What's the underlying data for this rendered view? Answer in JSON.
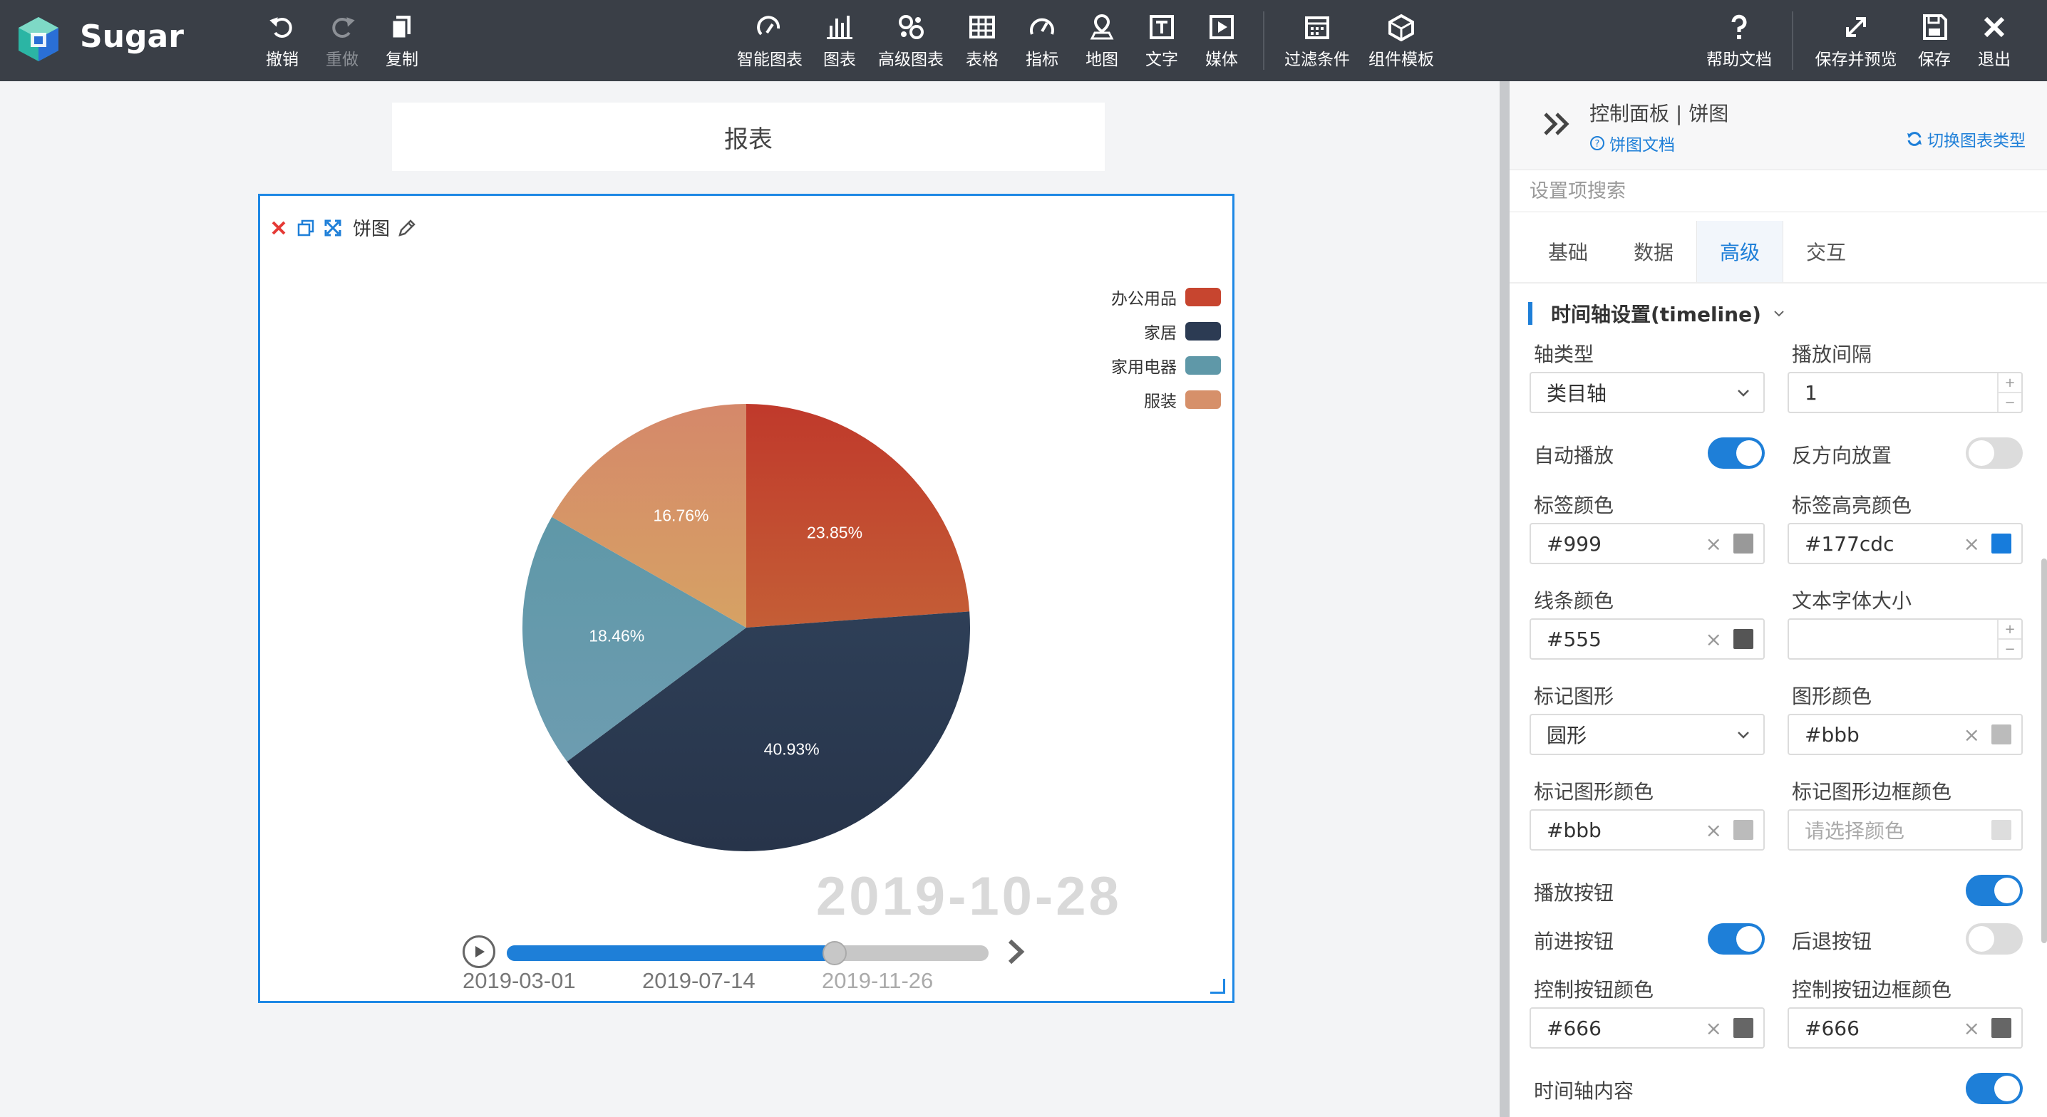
{
  "app": {
    "name": "Sugar"
  },
  "toolbar": {
    "left": [
      {
        "label": "撤销",
        "icon": "undo-icon"
      },
      {
        "label": "重做",
        "icon": "redo-icon"
      },
      {
        "label": "复制",
        "icon": "copy-icon"
      }
    ],
    "center": [
      {
        "label": "智能图表",
        "icon": "smart-chart-icon"
      },
      {
        "label": "图表",
        "icon": "bar-chart-icon"
      },
      {
        "label": "高级图表",
        "icon": "advanced-chart-icon"
      },
      {
        "label": "表格",
        "icon": "table-icon"
      },
      {
        "label": "指标",
        "icon": "gauge-icon"
      },
      {
        "label": "地图",
        "icon": "map-pin-icon"
      },
      {
        "label": "文字",
        "icon": "text-icon"
      },
      {
        "label": "媒体",
        "icon": "media-icon"
      },
      {
        "label": "过滤条件",
        "icon": "filter-calendar-icon"
      },
      {
        "label": "组件模板",
        "icon": "template-cube-icon"
      }
    ],
    "right": [
      {
        "label": "帮助文档",
        "icon": "help-icon"
      },
      {
        "label": "保存并预览",
        "icon": "expand-icon"
      },
      {
        "label": "保存",
        "icon": "save-icon"
      },
      {
        "label": "退出",
        "icon": "close-icon"
      }
    ]
  },
  "canvas": {
    "report_title": "报表",
    "card_name": "饼图"
  },
  "chart_data": {
    "type": "pie",
    "categories": [
      "办公用品",
      "家居",
      "家用电器",
      "服装"
    ],
    "values": [
      23.85,
      40.93,
      18.46,
      16.76
    ],
    "labels": [
      "23.85%",
      "40.93%",
      "18.46%",
      "16.76%"
    ],
    "colors": [
      [
        "#c0392b",
        "#c45e36"
      ],
      [
        "#2e3f57",
        "#27344a"
      ],
      [
        "#5f98a8",
        "#6d9cb0"
      ],
      [
        "#d5886a",
        "#d6a264"
      ]
    ],
    "legend_position": "top-right",
    "timeline": {
      "current": "2019-10-28",
      "ticks": [
        "2019-03-01",
        "2019-07-14",
        "2019-11-26"
      ],
      "progress": 0.68
    }
  },
  "panel": {
    "title": "控制面板 | 饼图",
    "doc_link": "饼图文档",
    "switch_type": "切换图表类型",
    "search_placeholder": "设置项搜索",
    "tabs": [
      "基础",
      "数据",
      "高级",
      "交互"
    ],
    "active_tab": "高级",
    "section_title": "时间轴设置(timeline)",
    "fields": {
      "axis_type": {
        "label": "轴类型",
        "value": "类目轴"
      },
      "play_interval": {
        "label": "播放间隔",
        "value": "1"
      },
      "auto_play": {
        "label": "自动播放",
        "on": true
      },
      "reverse": {
        "label": "反方向放置",
        "on": false
      },
      "label_color": {
        "label": "标签颜色",
        "value": "#999",
        "swatch": "#999999"
      },
      "label_highlight_color": {
        "label": "标签高亮颜色",
        "value": "#177cdc",
        "swatch": "#177cdc"
      },
      "line_color": {
        "label": "线条颜色",
        "value": "#555",
        "swatch": "#555555"
      },
      "font_size": {
        "label": "文本字体大小",
        "value": ""
      },
      "marker_shape": {
        "label": "标记图形",
        "value": "圆形"
      },
      "shape_color": {
        "label": "图形颜色",
        "value": "#bbb",
        "swatch": "#bbbbbb"
      },
      "marker_color": {
        "label": "标记图形颜色",
        "value": "#bbb",
        "swatch": "#bbbbbb"
      },
      "marker_border_color": {
        "label": "标记图形边框颜色",
        "placeholder": "请选择颜色",
        "swatch": "#dddddd"
      },
      "play_button": {
        "label": "播放按钮",
        "on": true
      },
      "forward_button": {
        "label": "前进按钮",
        "on": true
      },
      "back_button": {
        "label": "后退按钮",
        "on": false
      },
      "control_color": {
        "label": "控制按钮颜色",
        "value": "#666",
        "swatch": "#666666"
      },
      "control_border_color": {
        "label": "控制按钮边框颜色",
        "value": "#666",
        "swatch": "#666666"
      },
      "timeline_content": {
        "label": "时间轴内容",
        "on": true
      }
    }
  }
}
